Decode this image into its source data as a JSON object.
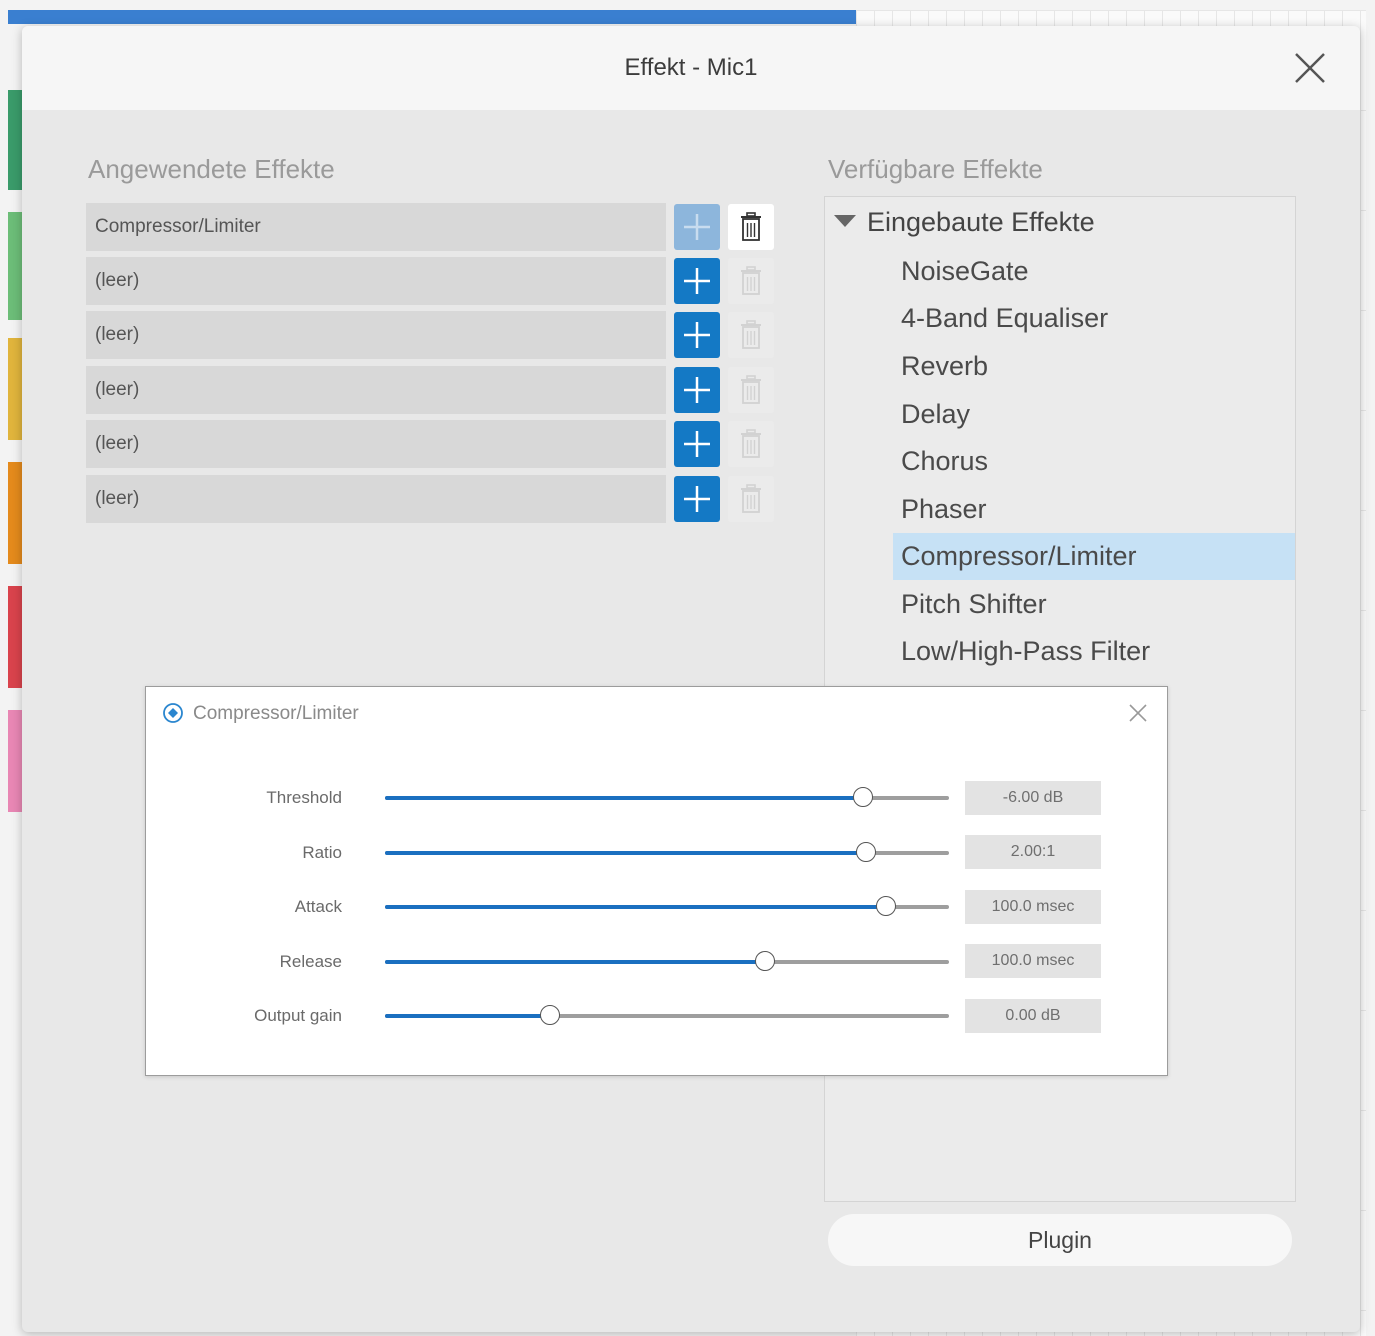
{
  "dialog": {
    "title": "Effekt - Mic1",
    "close_icon": "close-icon"
  },
  "applied": {
    "heading": "Angewendete Effekte",
    "slots": [
      {
        "label": "Compressor/Limiter"
      },
      {
        "label": "(leer)"
      },
      {
        "label": "(leer)"
      },
      {
        "label": "(leer)"
      },
      {
        "label": "(leer)"
      },
      {
        "label": "(leer)"
      }
    ]
  },
  "available": {
    "heading": "Verfügbare Effekte",
    "group_label": "Eingebaute Effekte",
    "items": [
      {
        "label": "NoiseGate"
      },
      {
        "label": "4-Band Equaliser"
      },
      {
        "label": "Reverb"
      },
      {
        "label": "Delay"
      },
      {
        "label": "Chorus"
      },
      {
        "label": "Phaser"
      },
      {
        "label": "Compressor/Limiter"
      },
      {
        "label": "Pitch Shifter"
      },
      {
        "label": "Low/High-Pass Filter"
      }
    ],
    "selected_item": "Compressor/Limiter",
    "plugin_button": "Plugin"
  },
  "compressor": {
    "title": "Compressor/Limiter",
    "params": [
      {
        "label": "Threshold",
        "value": "-6.00 dB",
        "level": 0.85
      },
      {
        "label": "Ratio",
        "value": "2.00:1",
        "level": 0.855
      },
      {
        "label": "Attack",
        "value": "100.0 msec",
        "level": 0.89
      },
      {
        "label": "Release",
        "value": "100.0 msec",
        "level": 0.675
      },
      {
        "label": "Output gain",
        "value": "0.00 dB",
        "level": 0.295
      }
    ]
  },
  "colors": {
    "accent": "#1479c5",
    "selected_row": "#c6e1f5",
    "slider_fill": "#1a6fc0"
  }
}
